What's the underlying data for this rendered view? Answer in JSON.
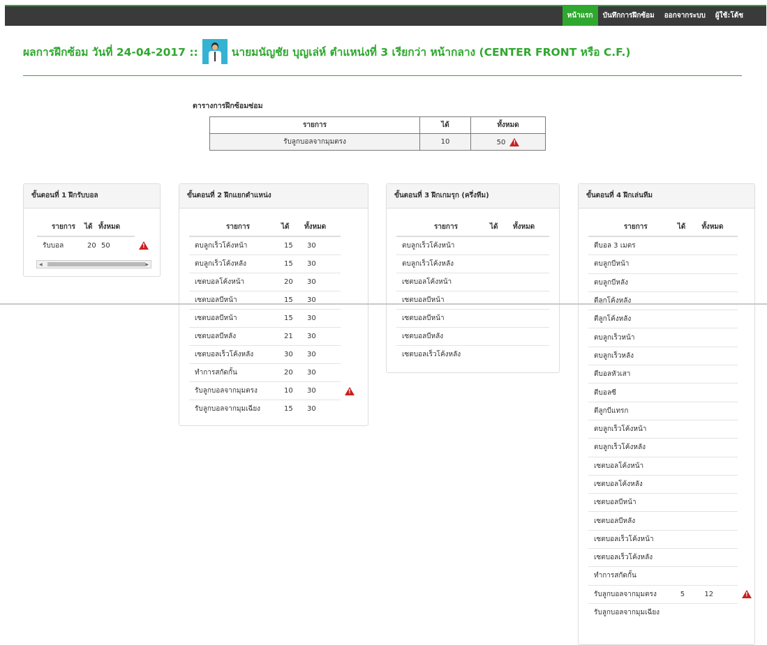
{
  "nav": {
    "items": [
      {
        "label": "หน้าแรก",
        "active": true
      },
      {
        "label": "บันทึกการฝึกซ้อม",
        "active": false
      },
      {
        "label": "ออกจากระบบ",
        "active": false
      },
      {
        "label": "ผู้ใช้:โต้ช",
        "active": false
      }
    ]
  },
  "header": {
    "title_prefix": "ผลการฝึกซ้อม วันที่ 24-04-2017 ::",
    "title_suffix": "นายมนัญชัย บุญเล่ห์  ตำแหน่งที่ 3 เรียกว่า หน้ากลาง (CENTER FRONT หรือ C.F.)"
  },
  "summary": {
    "title": "ตารางการฝึกซ้อมซ่อม",
    "columns": [
      "รายการ",
      "ได้",
      "ทั้งหมด"
    ],
    "rows": [
      {
        "item": "รับลูกบอลจากมุมตรง",
        "got": "10",
        "total": "50",
        "warning": true
      }
    ]
  },
  "stages": [
    {
      "title": "ขั้นตอนที่ 1 ฝึกรับบอล",
      "columns": [
        "รายการ",
        "ได้",
        "ทั้งหมด"
      ],
      "rows": [
        {
          "item": "รับบอล",
          "got": "20",
          "total": "50",
          "warning": true
        }
      ]
    },
    {
      "title": "ขั้นตอนที่ 2 ฝึกแยกตำแหน่ง",
      "columns": [
        "รายการ",
        "ได้",
        "ทั้งหมด"
      ],
      "rows": [
        {
          "item": "ตบลูกเร็วโค้งหน้า",
          "got": "15",
          "total": "30",
          "warning": false
        },
        {
          "item": "ตบลูกเร็วโค้งหลัง",
          "got": "15",
          "total": "30",
          "warning": false
        },
        {
          "item": "เซตบอลโค้งหน้า",
          "got": "20",
          "total": "30",
          "warning": false
        },
        {
          "item": "เซตบอลบีหน้า",
          "got": "15",
          "total": "30",
          "warning": false
        },
        {
          "item": "เซตบอลบีหน้า",
          "got": "15",
          "total": "30",
          "warning": false
        },
        {
          "item": "เซตบอลบีหลัง",
          "got": "21",
          "total": "30",
          "warning": false
        },
        {
          "item": "เซตบอลเร็วโค้งหลัง",
          "got": "30",
          "total": "30",
          "warning": false
        },
        {
          "item": "ทำการสกัดกั้น",
          "got": "20",
          "total": "30",
          "warning": false
        },
        {
          "item": "รับลูกบอลจากมุมตรง",
          "got": "10",
          "total": "30",
          "warning": true
        },
        {
          "item": "รับลูกบอลจากมุมเฉียง",
          "got": "15",
          "total": "30",
          "warning": false
        }
      ]
    },
    {
      "title": "ขั้นตอนที่ 3 ฝึกเกมรุก (ครึ่งทีม)",
      "columns": [
        "รายการ",
        "ได้",
        "ทั้งหมด"
      ],
      "rows": [
        {
          "item": "ตบลูกเร็วโค้งหน้า",
          "got": "",
          "total": "",
          "warning": false
        },
        {
          "item": "ตบลูกเร็วโค้งหลัง",
          "got": "",
          "total": "",
          "warning": false
        },
        {
          "item": "เซตบอลโค้งหน้า",
          "got": "",
          "total": "",
          "warning": false
        },
        {
          "item": "เซตบอลบีหน้า",
          "got": "",
          "total": "",
          "warning": false
        },
        {
          "item": "เซตบอลบีหน้า",
          "got": "",
          "total": "",
          "warning": false
        },
        {
          "item": "เซตบอลบีหลัง",
          "got": "",
          "total": "",
          "warning": false
        },
        {
          "item": "เซตบอลเร็วโค้งหลัง",
          "got": "",
          "total": "",
          "warning": false
        }
      ]
    },
    {
      "title": "ขั้นตอนที่ 4 ฝึกเล่นทีม",
      "columns": [
        "รายการ",
        "ได้",
        "ทั้งหมด"
      ],
      "rows": [
        {
          "item": "ตีบอล 3 เมตร",
          "got": "",
          "total": "",
          "warning": false
        },
        {
          "item": "ตบลูกบีหน้า",
          "got": "",
          "total": "",
          "warning": false
        },
        {
          "item": "ตบลูกบีหลัง",
          "got": "",
          "total": "",
          "warning": false
        },
        {
          "item": "ตีลูกโค้งหลัง",
          "got": "",
          "total": "",
          "warning": false
        },
        {
          "item": "ตีลูกโค้งหลัง",
          "got": "",
          "total": "",
          "warning": false
        },
        {
          "item": "ตบลูกเร็วหน้า",
          "got": "",
          "total": "",
          "warning": false
        },
        {
          "item": "ตบลูกเร็วหลัง",
          "got": "",
          "total": "",
          "warning": false
        },
        {
          "item": "ตีบอลหัวเสา",
          "got": "",
          "total": "",
          "warning": false
        },
        {
          "item": "ตีบอลซี",
          "got": "",
          "total": "",
          "warning": false
        },
        {
          "item": "ตีลูกบีแทรก",
          "got": "",
          "total": "",
          "warning": false
        },
        {
          "item": "ตบลูกเร็วโค้งหน้า",
          "got": "",
          "total": "",
          "warning": false
        },
        {
          "item": "ตบลูกเร็วโค้งหลัง",
          "got": "",
          "total": "",
          "warning": false
        },
        {
          "item": "เซตบอลโค้งหน้า",
          "got": "",
          "total": "",
          "warning": false
        },
        {
          "item": "เซตบอลโค้งหลัง",
          "got": "",
          "total": "",
          "warning": false
        },
        {
          "item": "เซตบอลบีหน้า",
          "got": "",
          "total": "",
          "warning": false
        },
        {
          "item": "เซตบอลบีหลัง",
          "got": "",
          "total": "",
          "warning": false
        },
        {
          "item": "เซตบอลเร็วโค้งหน้า",
          "got": "",
          "total": "",
          "warning": false
        },
        {
          "item": "เซตบอลเร็วโค้งหลัง",
          "got": "",
          "total": "",
          "warning": false
        },
        {
          "item": "ทำการสกัดกั้น",
          "got": "",
          "total": "",
          "warning": false
        },
        {
          "item": "รับลูกบอลจากมุมตรง",
          "got": "5",
          "total": "12",
          "warning": true
        },
        {
          "item": "รับลูกบอลจากมุมเฉียง",
          "got": "",
          "total": "",
          "warning": false
        }
      ]
    }
  ]
}
